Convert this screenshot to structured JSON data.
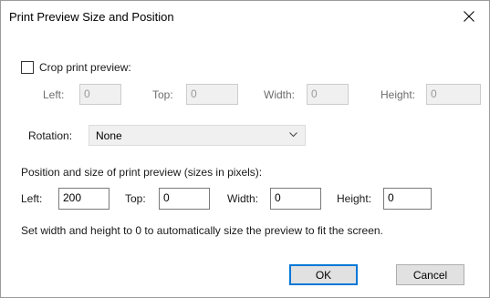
{
  "window": {
    "title": "Print Preview Size and Position",
    "close_icon": "close-icon"
  },
  "crop": {
    "checkbox_label": "Crop print preview:",
    "checked": false,
    "left_label": "Left:",
    "left_value": "0",
    "top_label": "Top:",
    "top_value": "0",
    "width_label": "Width:",
    "width_value": "0",
    "height_label": "Height:",
    "height_value": "0"
  },
  "rotation": {
    "label": "Rotation:",
    "selected": "None",
    "dropdown_icon": "chevron-down-icon"
  },
  "position": {
    "section_label": "Position and size of print preview (sizes in pixels):",
    "left_label": "Left:",
    "left_value": "200",
    "top_label": "Top:",
    "top_value": "0",
    "width_label": "Width:",
    "width_value": "0",
    "height_label": "Height:",
    "height_value": "0"
  },
  "hint": "Set width and height to 0 to automatically size the preview to fit the screen.",
  "buttons": {
    "ok": "OK",
    "cancel": "Cancel"
  }
}
